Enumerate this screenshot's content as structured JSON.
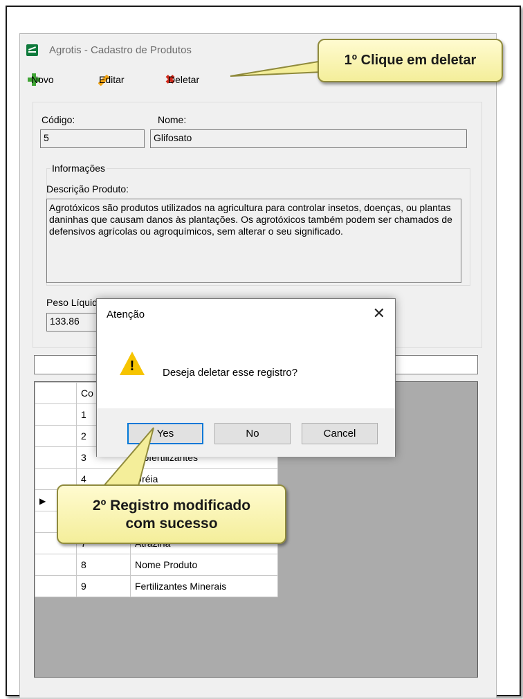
{
  "window": {
    "title": "Agrotis - Cadastro de Produtos"
  },
  "toolbar": {
    "novo_label": "Novo",
    "editar_label": "Editar",
    "deletar_label": "Deletar"
  },
  "form": {
    "codigo_label": "Código:",
    "codigo_value": "5",
    "nome_label": "Nome:",
    "nome_value": "Glifosato",
    "info_group_title": "Informações",
    "descricao_label": "Descrição Produto:",
    "descricao_value": "Agrotóxicos são produtos utilizados na agricultura para controlar insetos, doenças, ou plantas daninhas que causam danos às plantações. Os agrotóxicos também podem ser chamados de defensivos agrícolas ou agroquímicos, sem alterar o seu significado.",
    "peso_label": "Peso Líquido:",
    "peso_value": "133.86"
  },
  "grid": {
    "header_codigo": "Co",
    "rows": [
      {
        "codigo": "1",
        "nome": ""
      },
      {
        "codigo": "2",
        "nome": ""
      },
      {
        "codigo": "3",
        "nome": "Biofertilizantes"
      },
      {
        "codigo": "4",
        "nome": "Uréia"
      },
      {
        "codigo": "",
        "nome": ""
      },
      {
        "codigo": "",
        "nome": ""
      },
      {
        "codigo": "7",
        "nome": "Atrazina"
      },
      {
        "codigo": "8",
        "nome": "Nome Produto"
      },
      {
        "codigo": "9",
        "nome": "Fertilizantes Minerais"
      }
    ]
  },
  "dialog": {
    "title": "Atenção",
    "message": "Deseja deletar esse registro?",
    "yes_label": "Yes",
    "no_label": "No",
    "cancel_label": "Cancel"
  },
  "callouts": {
    "step1": "1º Clique em deletar",
    "step2_line1": "2º Registro modificado",
    "step2_line2": "com sucesso"
  },
  "colors": {
    "accent_blue": "#0078d7",
    "callout_fill": "#f4ee9a",
    "delete_red": "#d22a1b",
    "add_green": "#3fa435",
    "warning_yellow": "#f6c400"
  }
}
